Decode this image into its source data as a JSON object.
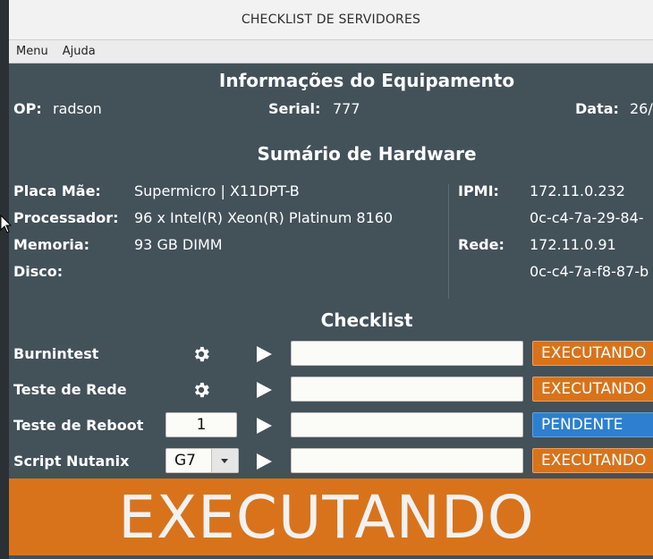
{
  "window": {
    "title": "CHECKLIST DE SERVIDORES"
  },
  "menu": {
    "items": [
      "Menu",
      "Ajuda"
    ]
  },
  "equipment": {
    "heading": "Informações do Equipamento",
    "op_label": "OP:",
    "op_value": "radson",
    "serial_label": "Serial:",
    "serial_value": "777",
    "date_label": "Data:",
    "date_value": "26/"
  },
  "hardware": {
    "heading": "Sumário de Hardware",
    "motherboard_label": "Placa Mãe:",
    "motherboard_value": "Supermicro | X11DPT-B",
    "processor_label": "Processador:",
    "processor_value": "96 x Intel(R) Xeon(R) Platinum 8160",
    "memory_label": "Memoria:",
    "memory_value": "93 GB DIMM",
    "disk_label": "Disco:",
    "ipmi_label": "IPMI:",
    "ipmi_ip": "172.11.0.232",
    "ipmi_mac": "0c-c4-7a-29-84-",
    "network_label": "Rede:",
    "network_ip": "172.11.0.91",
    "network_mac": "0c-c4-7a-f8-87-b"
  },
  "checklist": {
    "heading": "Checklist",
    "rows": [
      {
        "label": "Burnintest",
        "status": "EXECUTANDO"
      },
      {
        "label": "Teste de Rede",
        "status": "EXECUTANDO"
      },
      {
        "label": "Teste de Reboot",
        "spin_value": "1",
        "status": "PENDENTE"
      },
      {
        "label": "Script Nutanix",
        "combo_value": "G7",
        "status": "EXECUTANDO"
      }
    ]
  },
  "banner": {
    "text": "EXECUTANDO"
  },
  "colors": {
    "orange": "#d8731b",
    "blue": "#2e7fd0",
    "panel": "#435159"
  }
}
